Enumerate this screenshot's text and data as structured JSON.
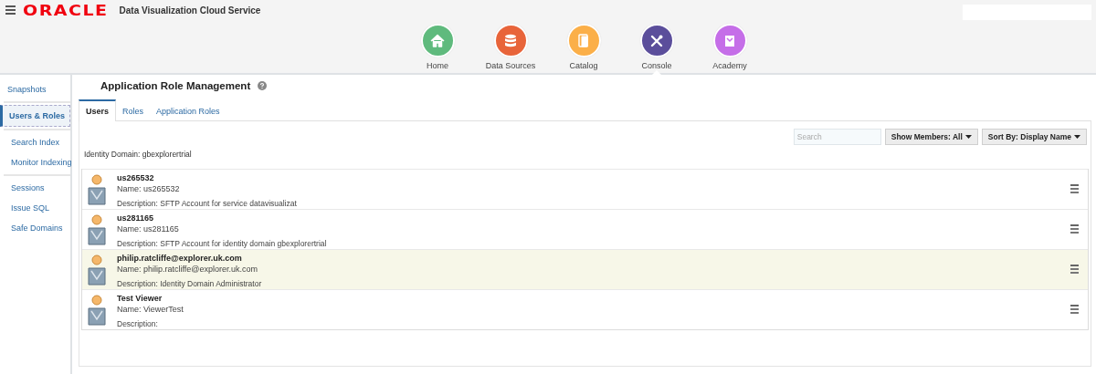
{
  "header": {
    "logo": "ORACLE",
    "title": "Data Visualization Cloud Service"
  },
  "nav": [
    {
      "label": "Home",
      "kind": "home",
      "color": "#5fba7d",
      "selected": false
    },
    {
      "label": "Data Sources",
      "kind": "database",
      "color": "#e8643a",
      "selected": false
    },
    {
      "label": "Catalog",
      "kind": "catalog",
      "color": "#fbaf48",
      "selected": false
    },
    {
      "label": "Console",
      "kind": "tools",
      "color": "#5b4e9b",
      "selected": true
    },
    {
      "label": "Academy",
      "kind": "academy",
      "color": "#c56ee8",
      "selected": false
    }
  ],
  "sidebar": {
    "groups": [
      [
        {
          "label": "Snapshots",
          "selected": false
        }
      ],
      [
        {
          "label": "Users & Roles",
          "selected": true
        }
      ],
      [
        {
          "label": "Search Index",
          "selected": false
        },
        {
          "label": "Monitor Indexing",
          "selected": false
        }
      ],
      [
        {
          "label": "Sessions",
          "selected": false
        },
        {
          "label": "Issue SQL",
          "selected": false
        },
        {
          "label": "Safe Domains",
          "selected": false
        }
      ]
    ]
  },
  "page": {
    "title": "Application Role Management",
    "tabs": [
      {
        "label": "Users",
        "selected": true
      },
      {
        "label": "Roles",
        "selected": false
      },
      {
        "label": "Application Roles",
        "selected": false
      }
    ],
    "search": {
      "placeholder": "Search"
    },
    "buttons": [
      "Show Members: All",
      "Sort By: Display Name"
    ],
    "identity_domain": "Identity Domain: gbexplorertrial",
    "users": [
      {
        "display_name": "us265532",
        "name": "Name: us265532",
        "description": "Description: SFTP Account for service datavisualizat",
        "selected": false
      },
      {
        "display_name": "us281165",
        "name": "Name: us281165",
        "description": "Description: SFTP Account for identity domain gbexplorertrial",
        "selected": false
      },
      {
        "display_name": "philip.ratcliffe@explorer.uk.com",
        "name": "Name: philip.ratcliffe@explorer.uk.com",
        "description": "Description: Identity Domain Administrator",
        "selected": true
      },
      {
        "display_name": "Test Viewer",
        "name": "Name: ViewerTest",
        "description": "Description:",
        "selected": false
      }
    ]
  }
}
